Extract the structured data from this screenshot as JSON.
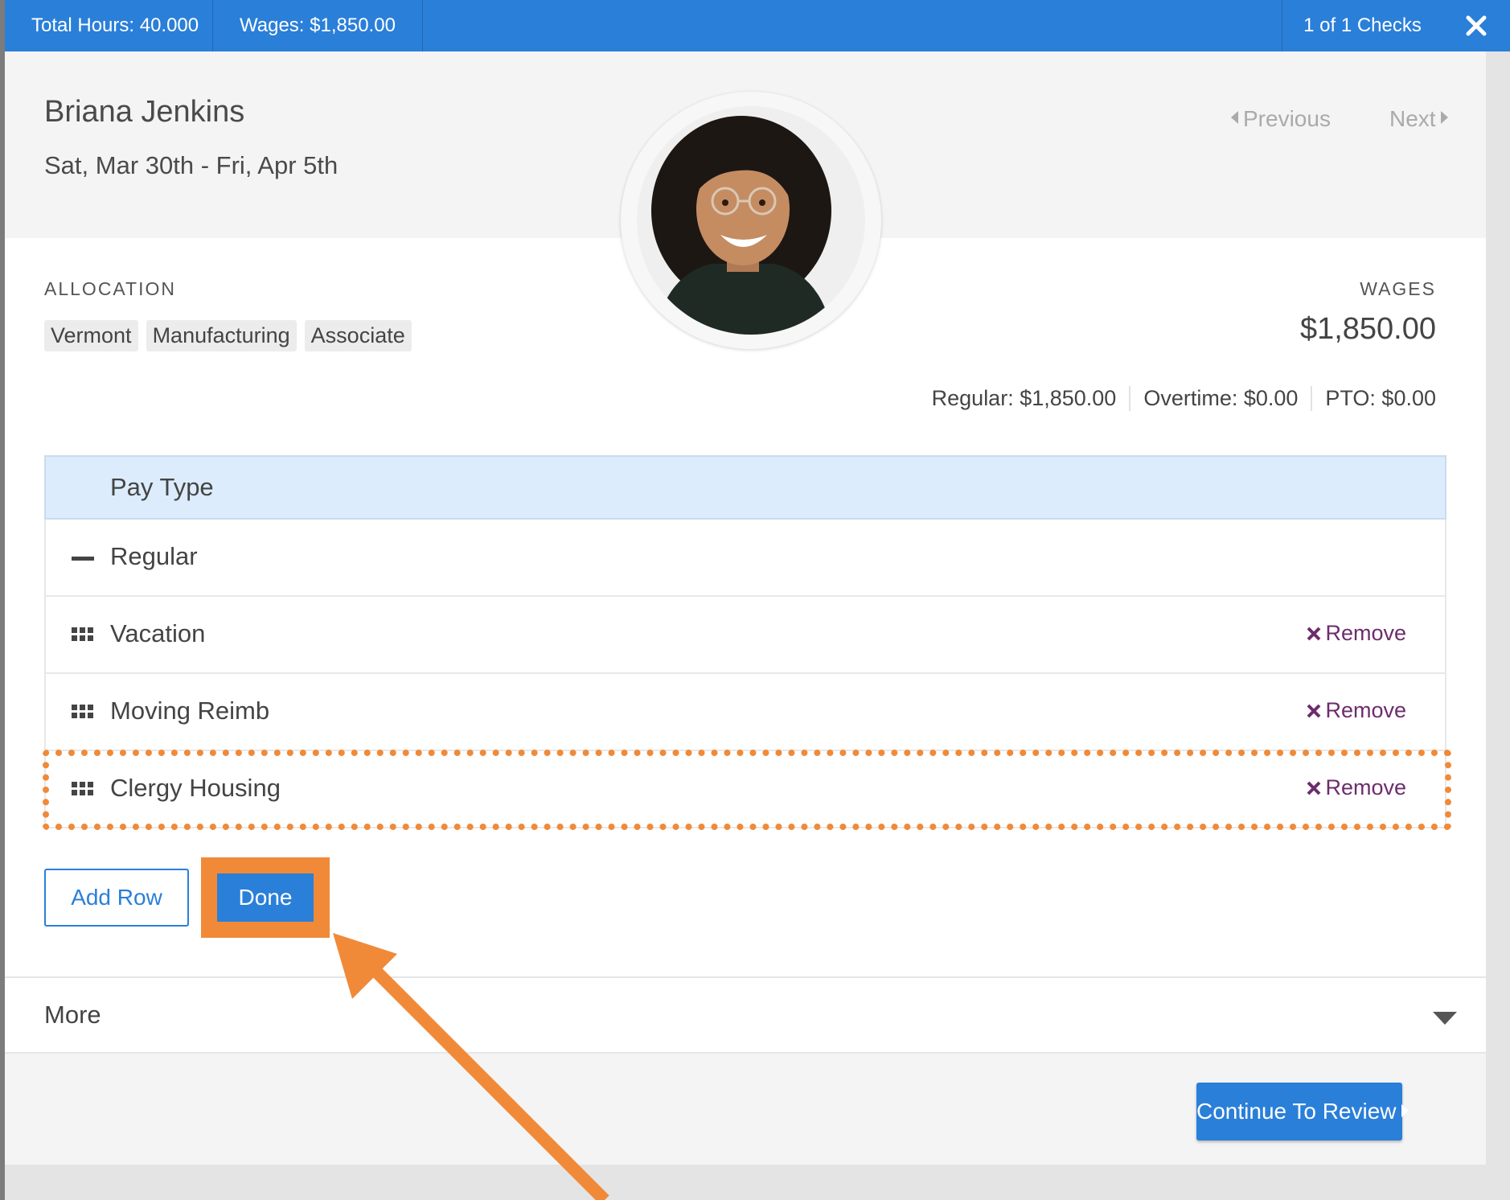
{
  "topbar": {
    "total_hours": "Total Hours: 40.000",
    "wages": "Wages: $1,850.00",
    "checks": "1 of 1 Checks",
    "close_icon": "close-icon"
  },
  "employee": {
    "name": "Briana Jenkins",
    "dates": "Sat, Mar 30th - Fri, Apr 5th"
  },
  "nav": {
    "previous": "Previous",
    "next": "Next"
  },
  "allocation": {
    "label": "ALLOCATION",
    "chips": [
      "Vermont",
      "Manufacturing",
      "Associate"
    ]
  },
  "wages": {
    "label": "WAGES",
    "amount": "$1,850.00",
    "regular": "Regular: $1,850.00",
    "overtime": "Overtime: $0.00",
    "pto": "PTO: $0.00"
  },
  "pay_table": {
    "header": "Pay Type",
    "rows": [
      {
        "label": "Regular",
        "icon": "minus-icon"
      },
      {
        "label": "Vacation",
        "icon": "drag-handle-icon",
        "remove": "Remove"
      },
      {
        "label": "Moving Reimb",
        "icon": "drag-handle-icon",
        "remove": "Remove"
      },
      {
        "label": "Clergy Housing",
        "icon": "drag-handle-icon",
        "remove": "Remove"
      }
    ]
  },
  "buttons": {
    "add_row": "Add Row",
    "done": "Done",
    "continue": "Continue To Review"
  },
  "more": {
    "label": "More"
  },
  "colors": {
    "primary": "#2a7fd9",
    "annotation": "#f08a39",
    "remove": "#6d2c6d",
    "header_bg": "#dcecfc"
  }
}
